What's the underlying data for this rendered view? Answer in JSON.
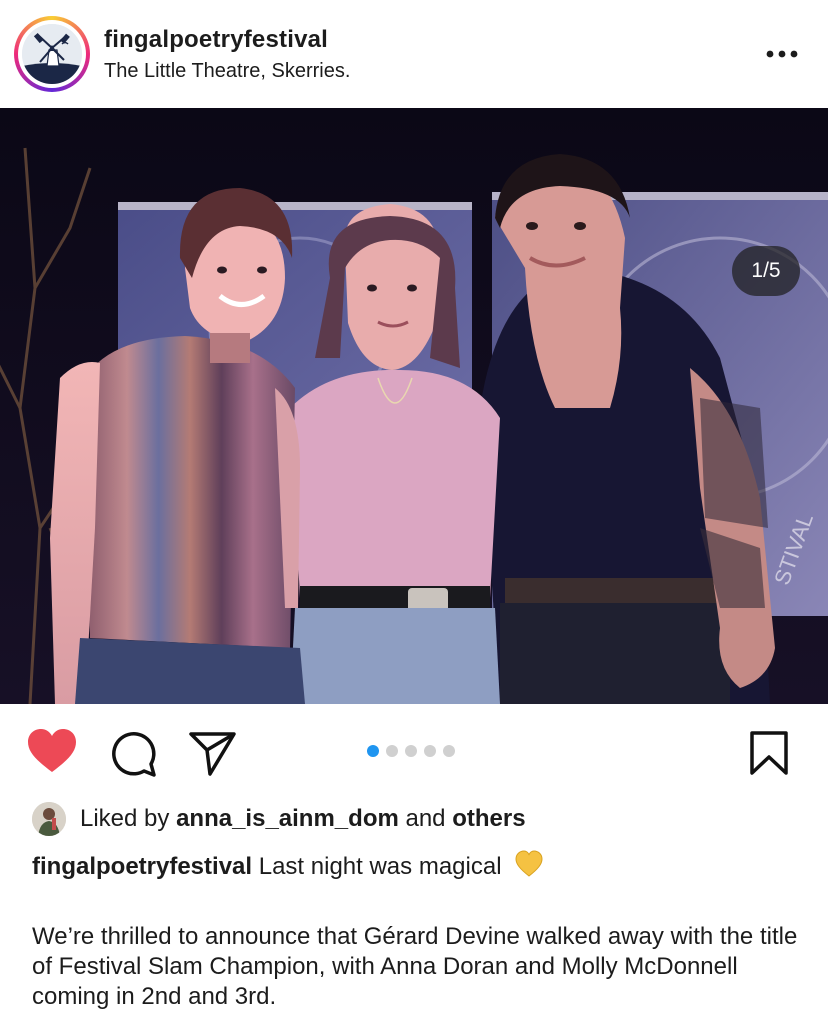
{
  "post": {
    "username": "fingalpoetryfestival",
    "location": "The Little Theatre, Skerries.",
    "counter": "1/5",
    "carousel": {
      "total": 5,
      "active_index": 0
    },
    "liked": true,
    "likes": {
      "prefix": "Liked by",
      "user": "anna_is_ainm_dom",
      "joiner": "and",
      "others": "others"
    },
    "caption": {
      "username": "fingalpoetryfestival",
      "headline": "Last night was magical",
      "body": "We’re thrilled to announce that Gérard Devine walked away with the title of Festival Slam Champion, with Anna Doran and Molly McDonnell coming in 2nd and 3rd."
    }
  },
  "icons": {
    "more": "more-options-icon",
    "like": "heart-icon",
    "comment": "comment-icon",
    "share": "share-icon",
    "save": "bookmark-icon",
    "caption_emoji": "yellow-heart-emoji"
  },
  "colors": {
    "like_red": "#ed4956",
    "carousel_active": "#1f95f0",
    "carousel_inactive": "#d0d0d0",
    "text": "#1c1c1c"
  }
}
